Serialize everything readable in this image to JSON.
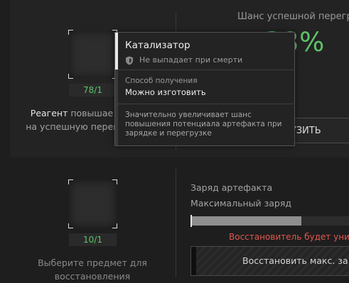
{
  "upgrade": {
    "chance_label": "Шанс успешной перегр",
    "chance_value": "38%",
    "button_label": "ГРУЗИТЬ",
    "reagent_count": "78/1",
    "reagent_name": "Реагент",
    "reagent_line1_rest": " повышае",
    "reagent_line2": "на успешную перег"
  },
  "restore": {
    "item_count": "10/1",
    "charge_label": "Заряд артефакта",
    "max_charge_label": "Максимальный заряд",
    "max_charge_fraction": 0.7,
    "warning": "Восстановитель будет унич",
    "button_label": "Восстановить макс. за",
    "select_line1": "Выберите предмет для",
    "select_line2": "восстановления"
  },
  "tooltip": {
    "title": "Катализатор",
    "drop_status": "Не выпадает при смерти",
    "source_label": "Способ получения",
    "source_value": "Можно изготовить",
    "description": "Значительно увеличивает шанс повышения потенциала артефакта при зарядке и перегрузке"
  },
  "colors": {
    "success": "#5ec26a",
    "warning": "#e0564e"
  }
}
